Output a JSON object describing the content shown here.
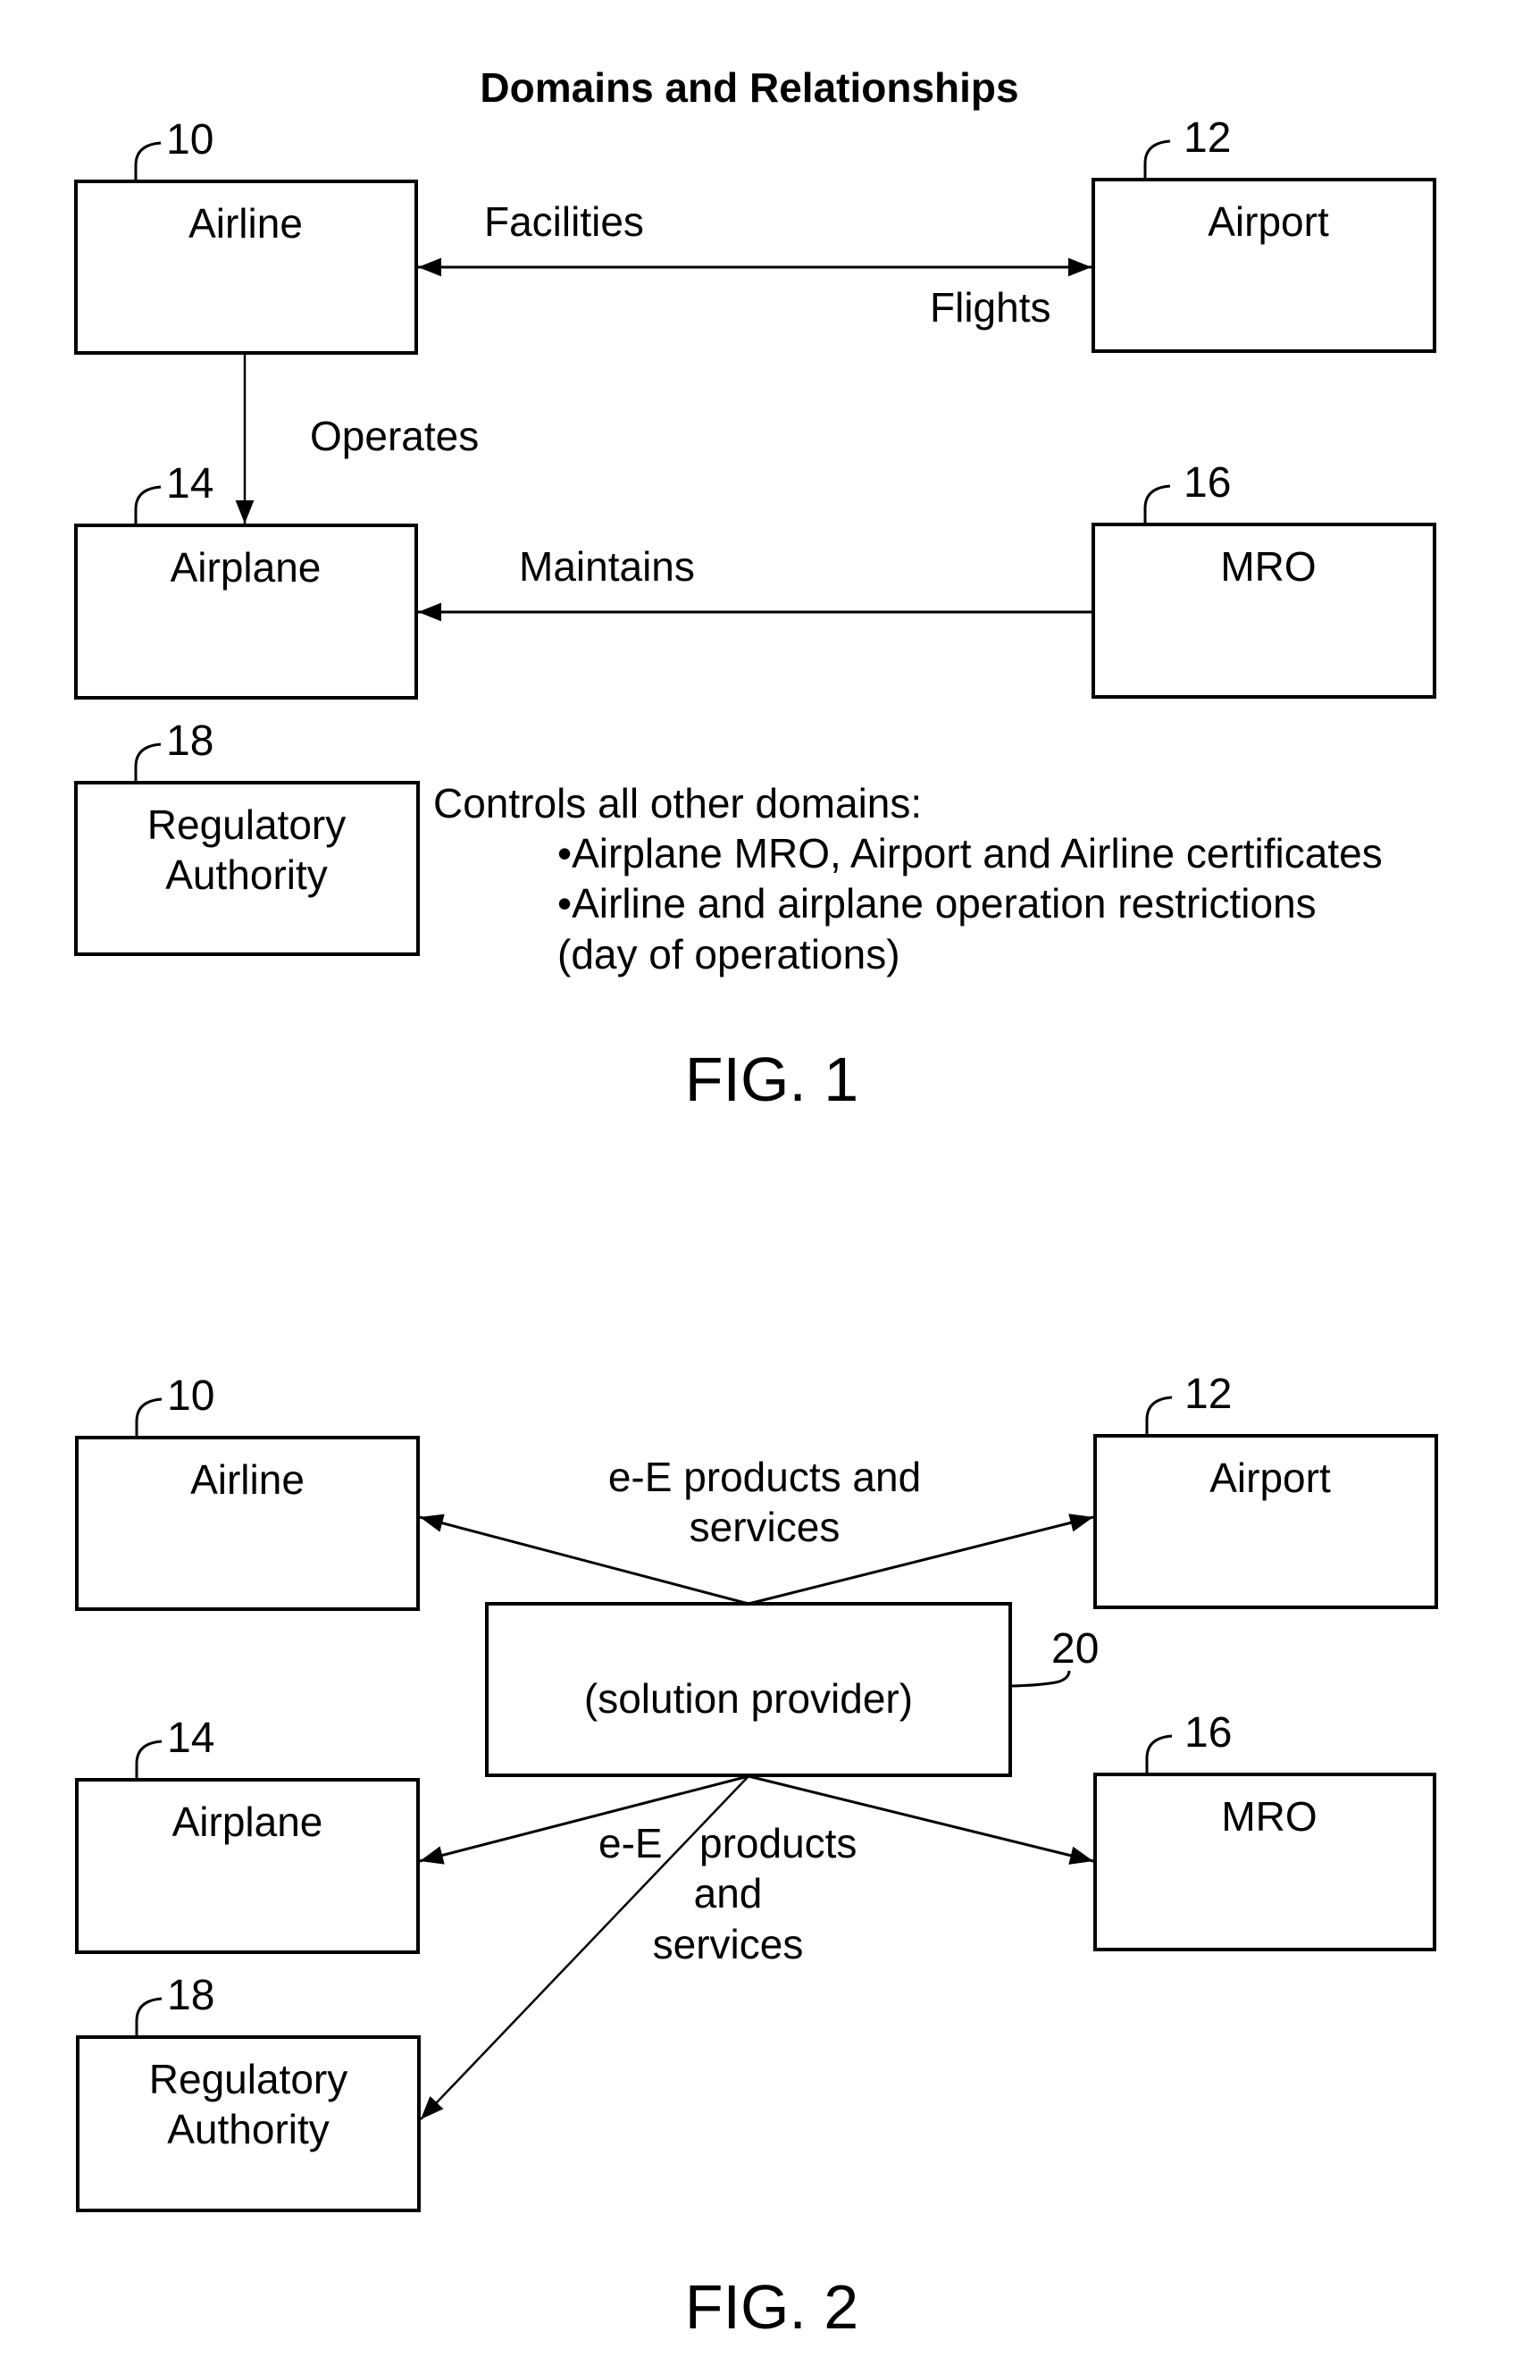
{
  "figure1": {
    "title": "Domains and Relationships",
    "boxes": {
      "airline": {
        "ref": "10",
        "label": "Airline"
      },
      "airport": {
        "ref": "12",
        "label": "Airport"
      },
      "airplane": {
        "ref": "14",
        "label": "Airplane"
      },
      "mro": {
        "ref": "16",
        "label": "MRO"
      },
      "regulatory": {
        "ref": "18",
        "label_line1": "Regulatory",
        "label_line2": "Authority"
      }
    },
    "relationships": {
      "facilities": "Facilities",
      "flights": "Flights",
      "operates": "Operates",
      "maintains": "Maintains"
    },
    "regulatory_note": {
      "heading": "Controls all other domains:",
      "bullets": [
        "•Airplane MRO, Airport and Airline certificates",
        "•Airline and airplane operation restrictions"
      ],
      "continuation": "(day of operations)"
    },
    "caption": "FIG. 1"
  },
  "figure2": {
    "boxes": {
      "airline": {
        "ref": "10",
        "label": "Airline"
      },
      "airport": {
        "ref": "12",
        "label": "Airport"
      },
      "solution_provider": {
        "ref": "20",
        "label": "(solution provider)"
      },
      "airplane": {
        "ref": "14",
        "label": "Airplane"
      },
      "mro": {
        "ref": "16",
        "label": "MRO"
      },
      "regulatory": {
        "ref": "18",
        "label_line1": "Regulatory",
        "label_line2": "Authority"
      }
    },
    "upper_label": {
      "line1": "e-E products and",
      "line2": "services"
    },
    "lower_label": {
      "word1": "e-E",
      "word2": "products",
      "line2": "and",
      "line3": "services"
    },
    "caption": "FIG. 2"
  }
}
